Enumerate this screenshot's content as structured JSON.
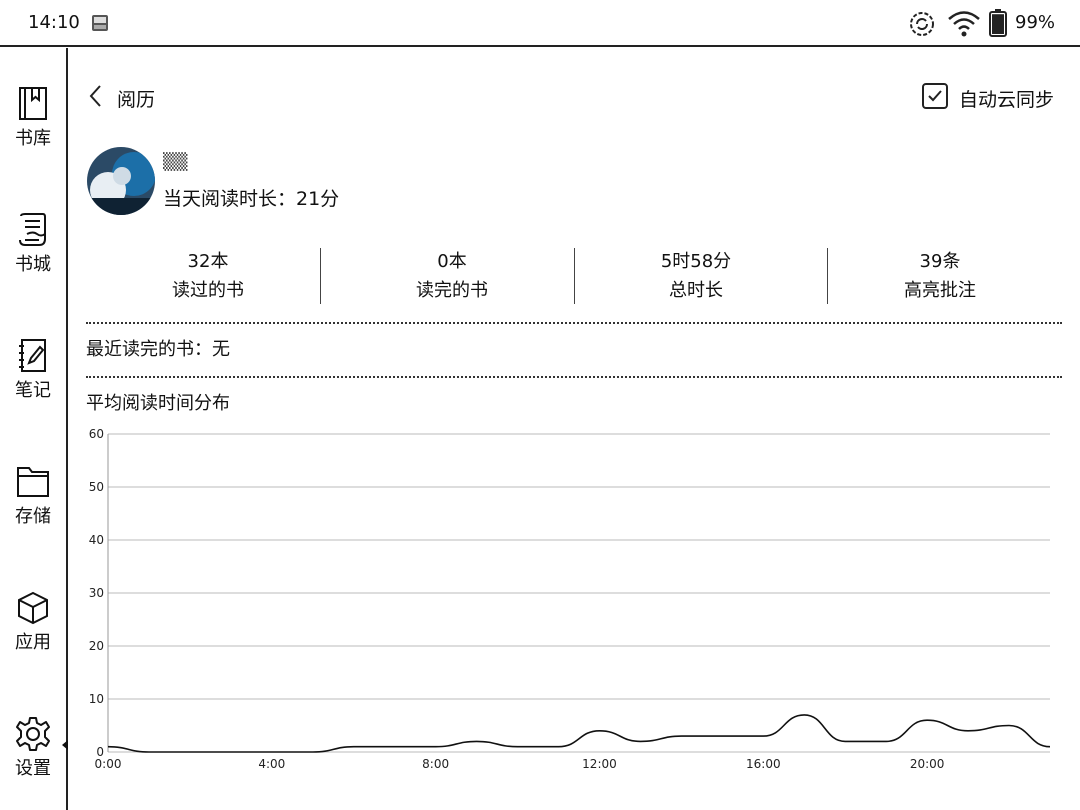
{
  "status": {
    "time": "14:10",
    "battery_pct": "99%",
    "battery_level": 0.99
  },
  "sidebar": {
    "items": [
      {
        "label": "书库",
        "icon": "bookshelf-icon"
      },
      {
        "label": "书城",
        "icon": "bookstore-icon"
      },
      {
        "label": "笔记",
        "icon": "notebook-icon"
      },
      {
        "label": "存储",
        "icon": "folder-icon"
      },
      {
        "label": "应用",
        "icon": "cube-icon"
      },
      {
        "label": "设置",
        "icon": "gear-icon"
      }
    ],
    "selected": "设置"
  },
  "header": {
    "title": "阅历",
    "sync_label": "自动云同步",
    "sync_checked": true
  },
  "profile": {
    "today_label": "当天阅读时长：21分"
  },
  "stats": [
    {
      "value": "32本",
      "label": "读过的书"
    },
    {
      "value": "0本",
      "label": "读完的书"
    },
    {
      "value": "5时58分",
      "label": "总时长"
    },
    {
      "value": "39条",
      "label": "高亮批注"
    }
  ],
  "recent": {
    "label": "最近读完的书：无"
  },
  "chart_title": "平均阅读时间分布",
  "chart_data": {
    "type": "line",
    "title": "平均阅读时间分布",
    "xlabel": "",
    "ylabel": "",
    "x_ticks": [
      "0:00",
      "4:00",
      "8:00",
      "12:00",
      "16:00",
      "20:00"
    ],
    "y_ticks": [
      0,
      10,
      20,
      30,
      40,
      50,
      60
    ],
    "xlim": [
      0,
      23
    ],
    "ylim": [
      0,
      60
    ],
    "grid": true,
    "series": [
      {
        "x": [
          0,
          1,
          2,
          3,
          4,
          5,
          6,
          7,
          8,
          9,
          10,
          11,
          12,
          13,
          14,
          15,
          16,
          17,
          18,
          19,
          20,
          21,
          22,
          23
        ],
        "values": [
          1,
          0,
          0,
          0,
          0,
          0,
          1,
          1,
          1,
          2,
          1,
          1,
          4,
          2,
          3,
          3,
          3,
          7,
          2,
          2,
          6,
          4,
          5,
          1
        ]
      }
    ]
  }
}
